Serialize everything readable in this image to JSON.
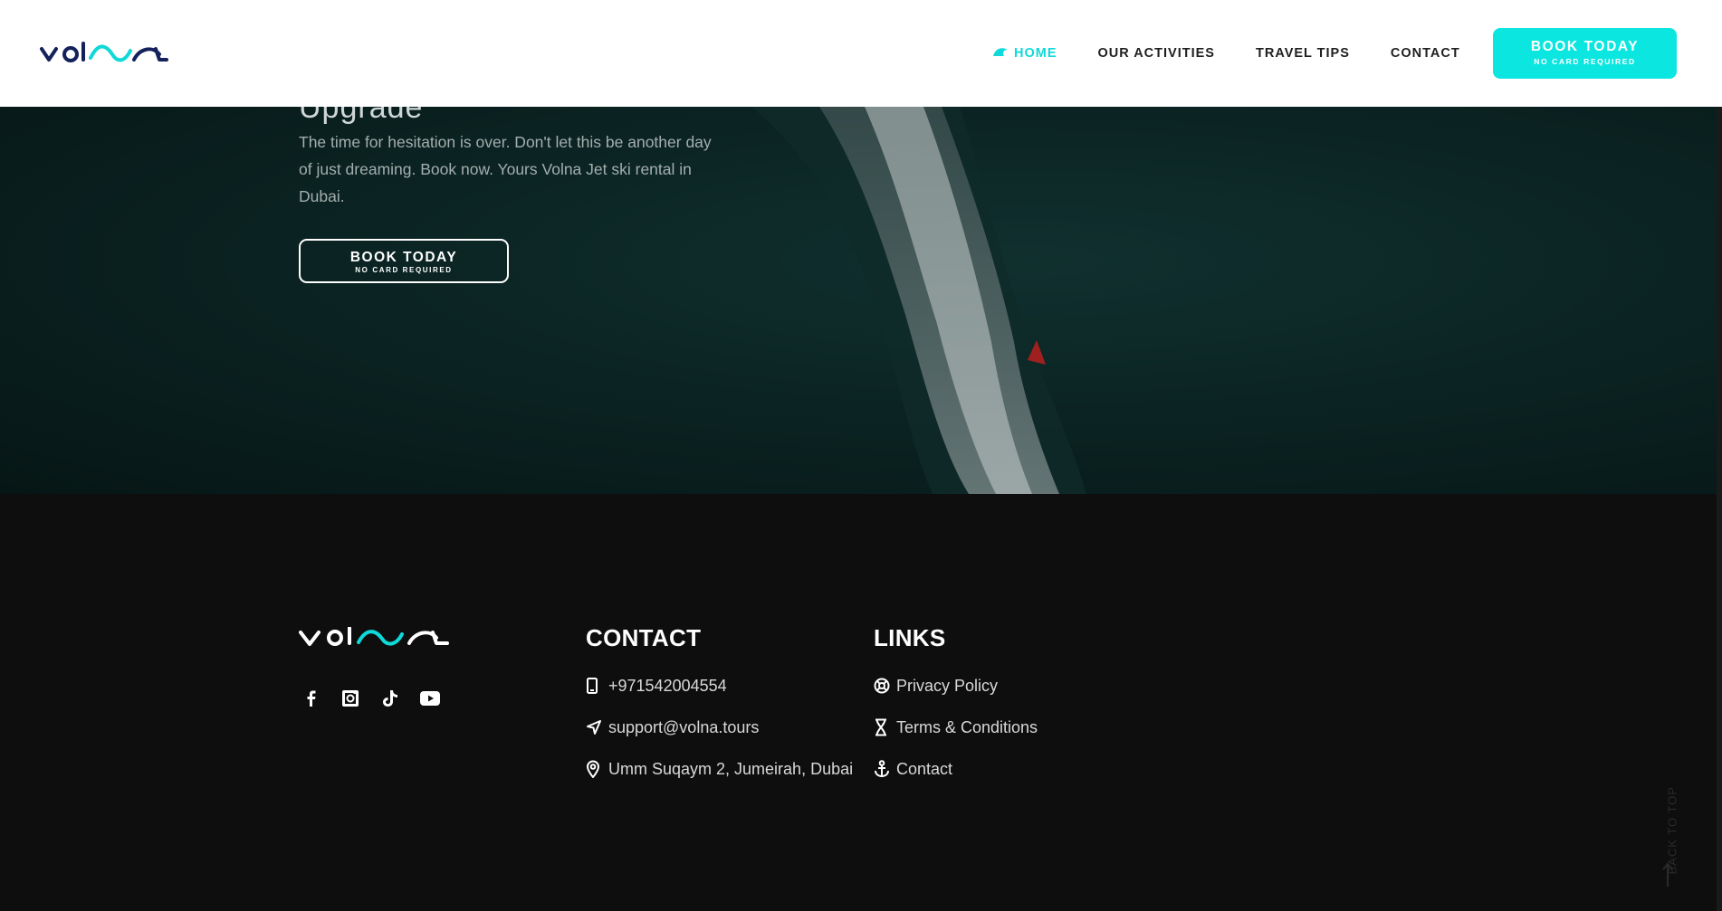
{
  "nav": {
    "items": [
      {
        "label": "HOME",
        "active": true
      },
      {
        "label": "OUR ACTIVITIES",
        "active": false
      },
      {
        "label": "TRAVEL TIPS",
        "active": false
      },
      {
        "label": "CONTACT",
        "active": false
      }
    ],
    "book_button": {
      "main": "BOOK TODAY",
      "sub": "NO CARD REQUIRED"
    }
  },
  "hero": {
    "cut_title": "Upgrade",
    "text": "The time for hesitation is over. Don't let this be another day of just dreaming. Book now. Yours Volna Jet ski rental in Dubai.",
    "button": {
      "main": "BOOK TODAY",
      "sub": "NO CARD REQUIRED"
    }
  },
  "footer": {
    "contact": {
      "title": "CONTACT",
      "items": [
        {
          "icon": "phone-icon",
          "text": "+971542004554"
        },
        {
          "icon": "send-icon",
          "text": "support@volna.tours"
        },
        {
          "icon": "location-pin-icon",
          "text": "Umm Suqaym 2, Jumeirah, Dubai"
        }
      ]
    },
    "links": {
      "title": "LINKS",
      "items": [
        {
          "icon": "lifebuoy-icon",
          "text": "Privacy Policy"
        },
        {
          "icon": "hourglass-icon",
          "text": "Terms & Conditions"
        },
        {
          "icon": "anchor-icon",
          "text": "Contact"
        }
      ]
    },
    "social": [
      "facebook-icon",
      "instagram-icon",
      "tiktok-icon",
      "youtube-icon"
    ],
    "back_to_top": "BACK TO TOP"
  },
  "colors": {
    "accent": "#0ce6e0",
    "header_bg": "#ffffff",
    "footer_bg": "#0e0e0e",
    "logo_dark": "#14215a"
  }
}
